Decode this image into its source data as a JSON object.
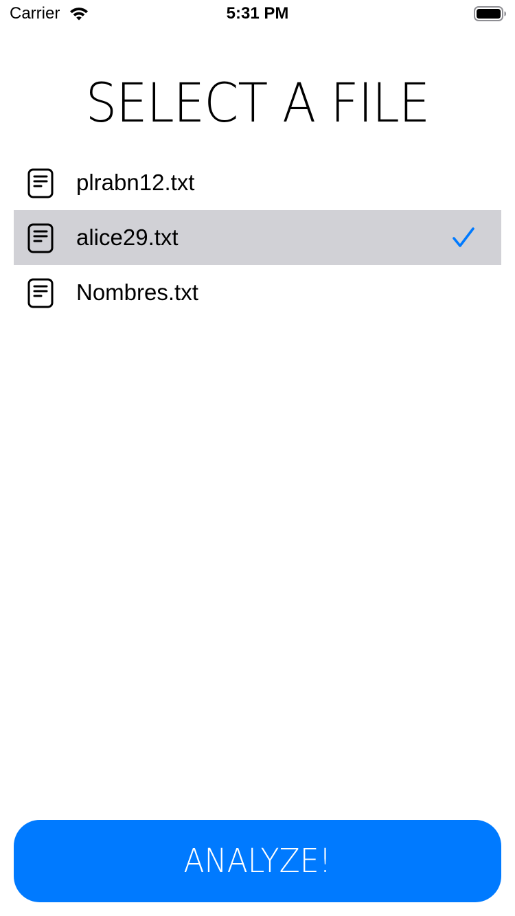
{
  "status_bar": {
    "carrier": "Carrier",
    "time": "5:31 PM"
  },
  "title": "SELECT A FILE",
  "files": [
    {
      "name": "plrabn12.txt",
      "icon": "document-icon",
      "selected": false
    },
    {
      "name": "alice29.txt",
      "icon": "document-icon",
      "selected": true
    },
    {
      "name": "Nombres.txt",
      "icon": "document-icon",
      "selected": false
    }
  ],
  "analyze_button": {
    "label": "ANALYZE!"
  },
  "colors": {
    "accent": "#007aff",
    "selected_row": "#d1d1d6",
    "background": "#ffffff"
  }
}
